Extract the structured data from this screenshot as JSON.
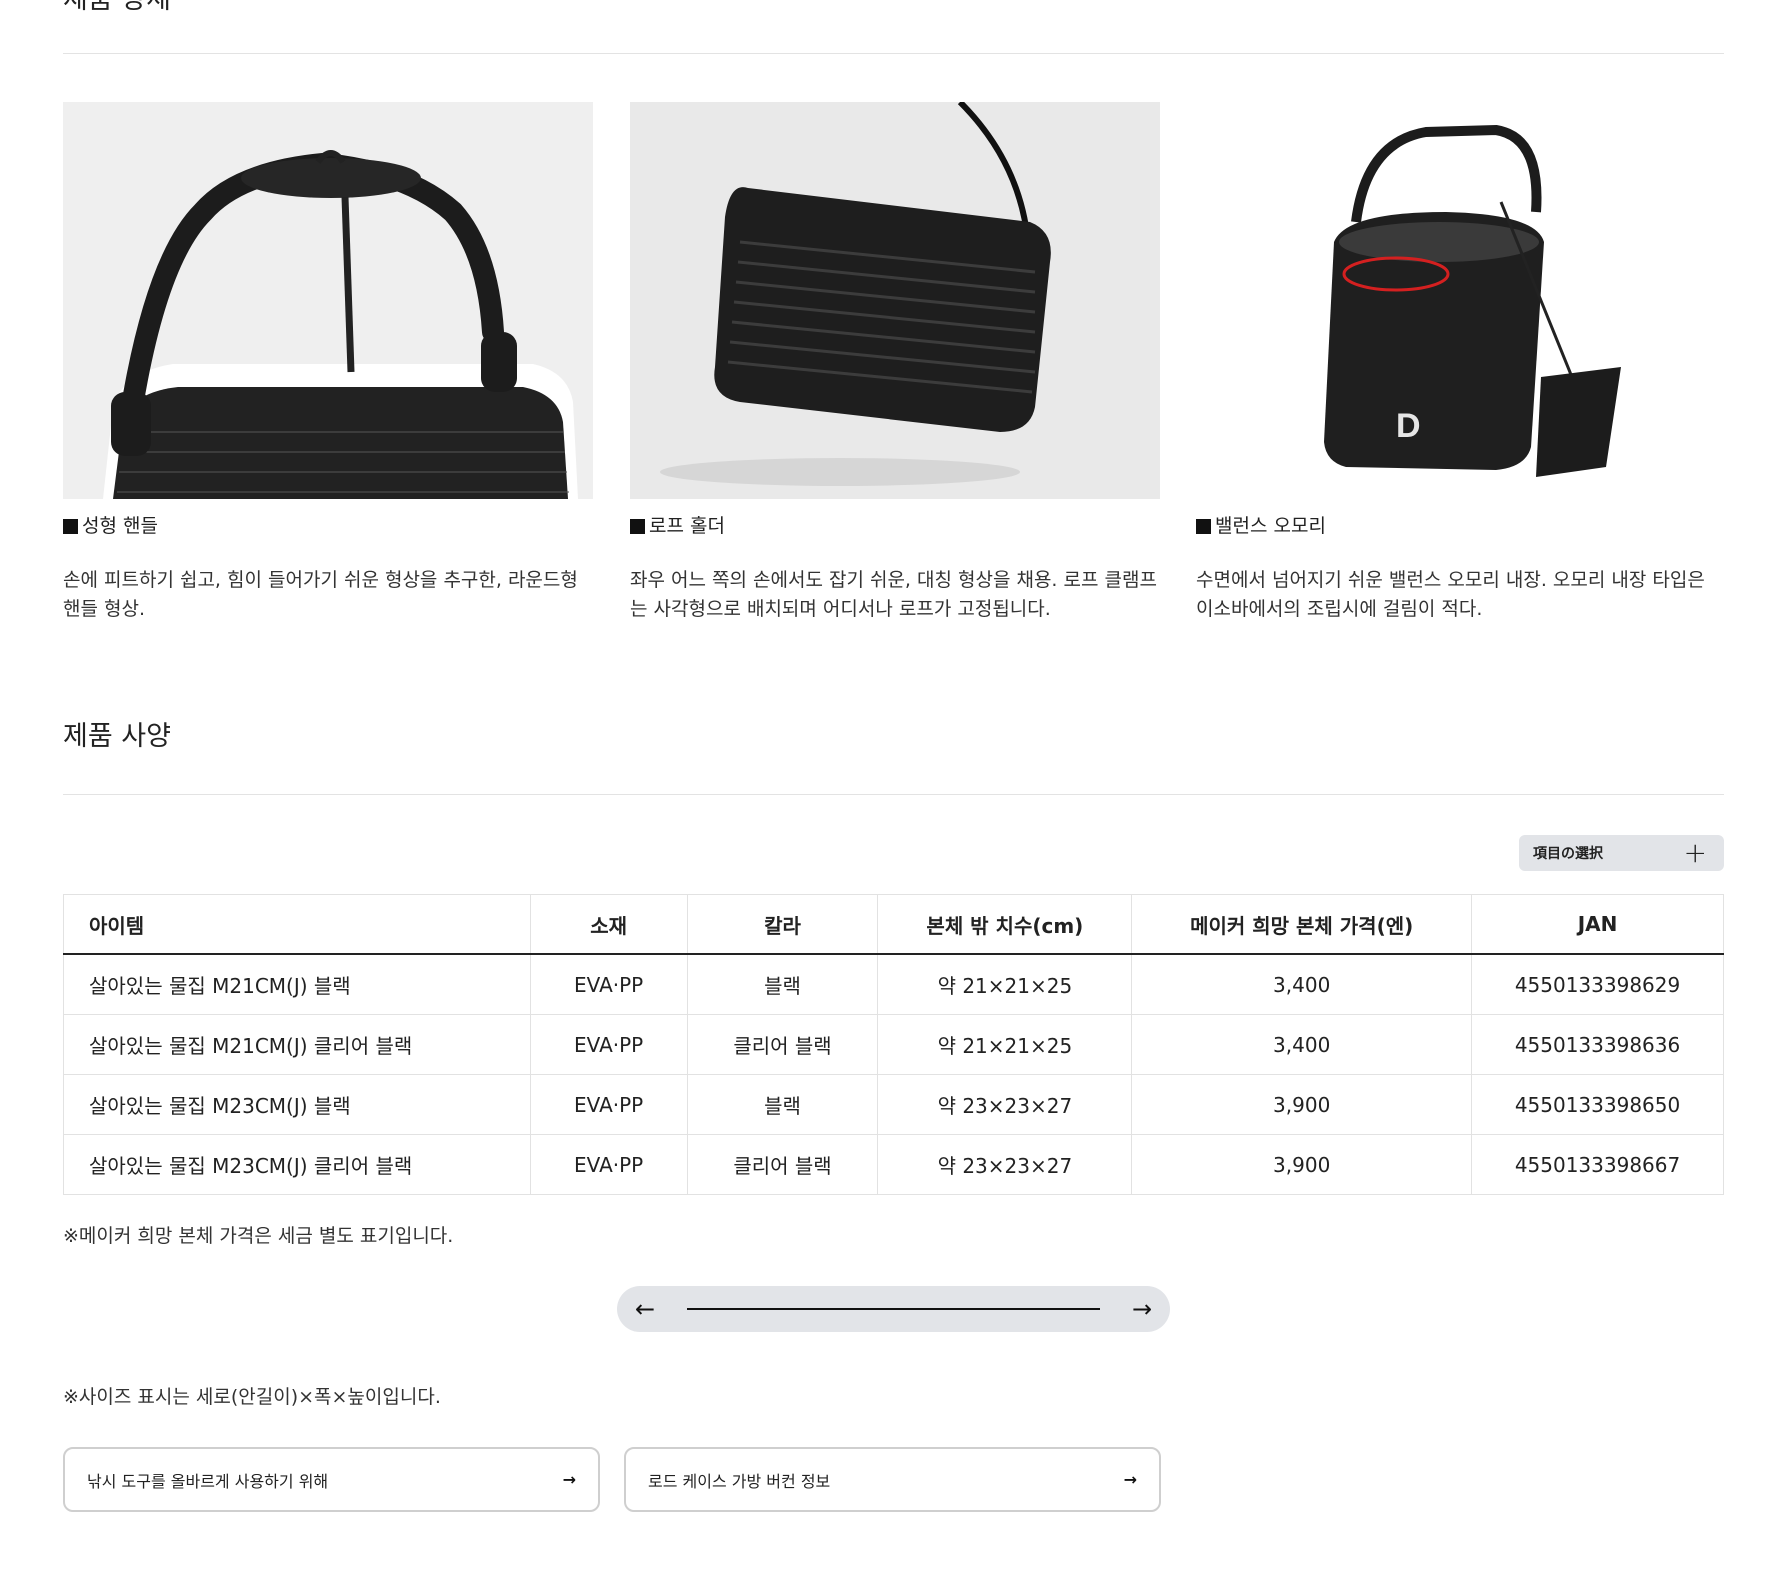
{
  "section_top": {
    "title": "제품 장세"
  },
  "features": [
    {
      "caption": "■ 성형 핸들",
      "caption_text": "성형 핸들",
      "description": "손에 피트하기 쉽고, 힘이 들어가기 쉬운 형상을 추구한, 라운드형 핸들 형상."
    },
    {
      "caption_text": "로프 홀더",
      "description": "좌우 어느 쪽의 손에서도 잡기 쉬운, 대칭 형상을 채용. 로프 클램프는 사각형으로 배치되며 어디서나 로프가 고정됩니다."
    },
    {
      "caption_text": "밸런스 오모리",
      "description": "수면에서 넘어지기 쉬운 밸런스 오모리 내장. 오모리 내장 타입은 이소바에서의 조립시에 걸림이 적다."
    }
  ],
  "spec": {
    "title": "제품 사양",
    "select_button": "項目の選択",
    "columns": [
      "아이템",
      "소재",
      "칼라",
      "본체 밖 치수(cm)",
      "메이커 희망 본체 가격(엔)",
      "JAN"
    ],
    "rows": [
      [
        "살아있는 물집 M21CM(J) 블랙",
        "EVA·PP",
        "블랙",
        "약 21×21×25",
        "3,400",
        "4550133398629"
      ],
      [
        "살아있는 물집 M21CM(J) 클리어 블랙",
        "EVA·PP",
        "클리어 블랙",
        "약 21×21×25",
        "3,400",
        "4550133398636"
      ],
      [
        "살아있는 물집 M23CM(J) 블랙",
        "EVA·PP",
        "블랙",
        "약 23×23×27",
        "3,900",
        "4550133398650"
      ],
      [
        "살아있는 물집 M23CM(J) 클리어 블랙",
        "EVA·PP",
        "클리어 블랙",
        "약 23×23×27",
        "3,900",
        "4550133398667"
      ]
    ],
    "note_price": "※메이커 희망 본체 가격은 세금 별도 표기입니다.",
    "note_size": "※사이즈 표시는 세로(안길이)×폭×높이입니다."
  },
  "scroller": {
    "left_icon": "arrow-left-icon",
    "right_icon": "arrow-right-icon"
  },
  "links": [
    {
      "label": "낚시 도구를 올바르게 사용하기 위해",
      "icon": "arrow-right-icon"
    },
    {
      "label": "로드 케이스 가방 버컨 정보",
      "icon": "arrow-right-icon"
    }
  ],
  "colors": {
    "accent_gray": "#e2e4e8",
    "highlight_red": "#d42020"
  }
}
